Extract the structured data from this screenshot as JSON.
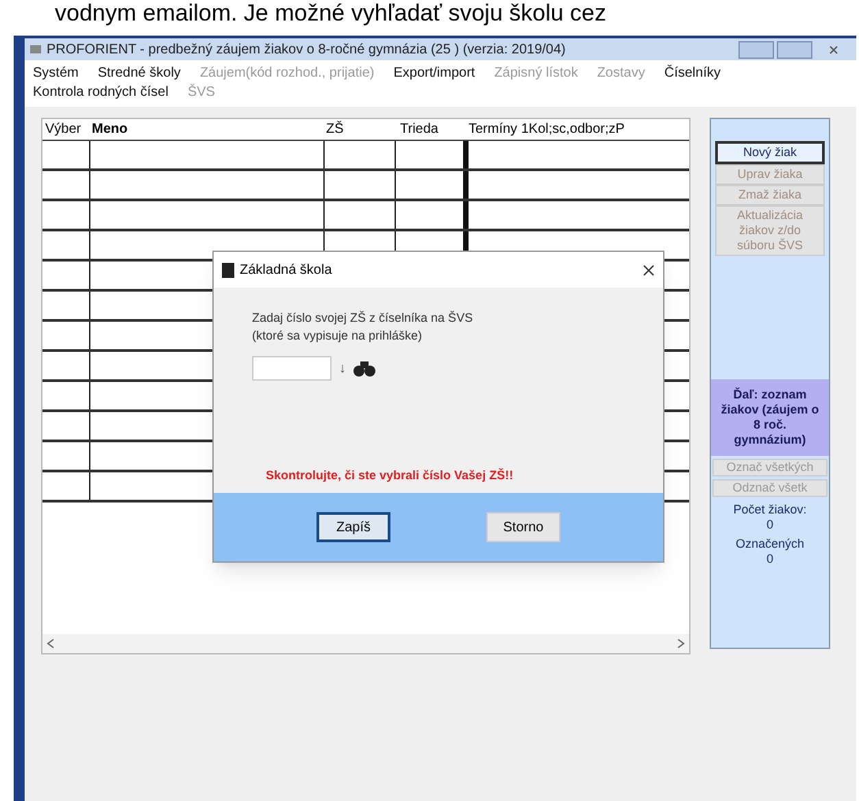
{
  "caption": "vodnym emailom. Je možné vyhľadať svoju školu cez",
  "window": {
    "title": "PROFORIENT - predbežný záujem žiakov o 8-ročné gymnázia (25 )   (verzia: 2019/04)"
  },
  "menu": [
    {
      "label": "Systém",
      "disabled": false
    },
    {
      "label": "Stredné školy",
      "disabled": false
    },
    {
      "label": "Záujem(kód rozhod., prijatie)",
      "disabled": true
    },
    {
      "label": "Export/import",
      "disabled": false
    },
    {
      "label": "Zápisný lístok",
      "disabled": true
    },
    {
      "label": "Zostavy",
      "disabled": true
    },
    {
      "label": "Číselníky",
      "disabled": false
    },
    {
      "label": "Kontrola rodných čísel",
      "disabled": false
    },
    {
      "label": "ŠVS",
      "disabled": true
    }
  ],
  "table": {
    "columns": [
      "Výber",
      "Meno",
      "ZŠ",
      "Trieda",
      "Termíny 1Kol;sc,odbor;zP"
    ]
  },
  "side_panel": {
    "buttons": [
      {
        "label": "Nový žiak",
        "disabled": false,
        "selected": true
      },
      {
        "label": "Uprav žiaka",
        "disabled": true,
        "selected": false
      },
      {
        "label": "Zmaž žiaka",
        "disabled": true,
        "selected": false
      },
      {
        "label": "Aktualizácia žiakov z/do súboru ŠVS",
        "disabled": true,
        "selected": false
      }
    ],
    "next_button": "Ďaľ: zoznam žiakov (záujem o 8 roč. gymnázium)",
    "mark_buttons": [
      {
        "label": "Označ všetkých",
        "disabled": true
      },
      {
        "label": "Odznač všetk",
        "disabled": true
      }
    ],
    "count_label": "Počet žiakov:",
    "count": "0",
    "marked_label": "Označených",
    "marked": "0"
  },
  "dialog": {
    "title": "Základná škola",
    "prompt": "Zadaj číslo svojej ZŠ z číselníka na ŠVS",
    "prompt_note": "(ktoré sa vypisuje na prihláške)",
    "dropdown_glyph": "↓",
    "warning": "Skontrolujte, či ste vybrali číslo Vašej ZŠ!!",
    "buttons": [
      {
        "label": "Zapíš",
        "selected": true
      },
      {
        "label": "Storno",
        "selected": false
      }
    ]
  }
}
